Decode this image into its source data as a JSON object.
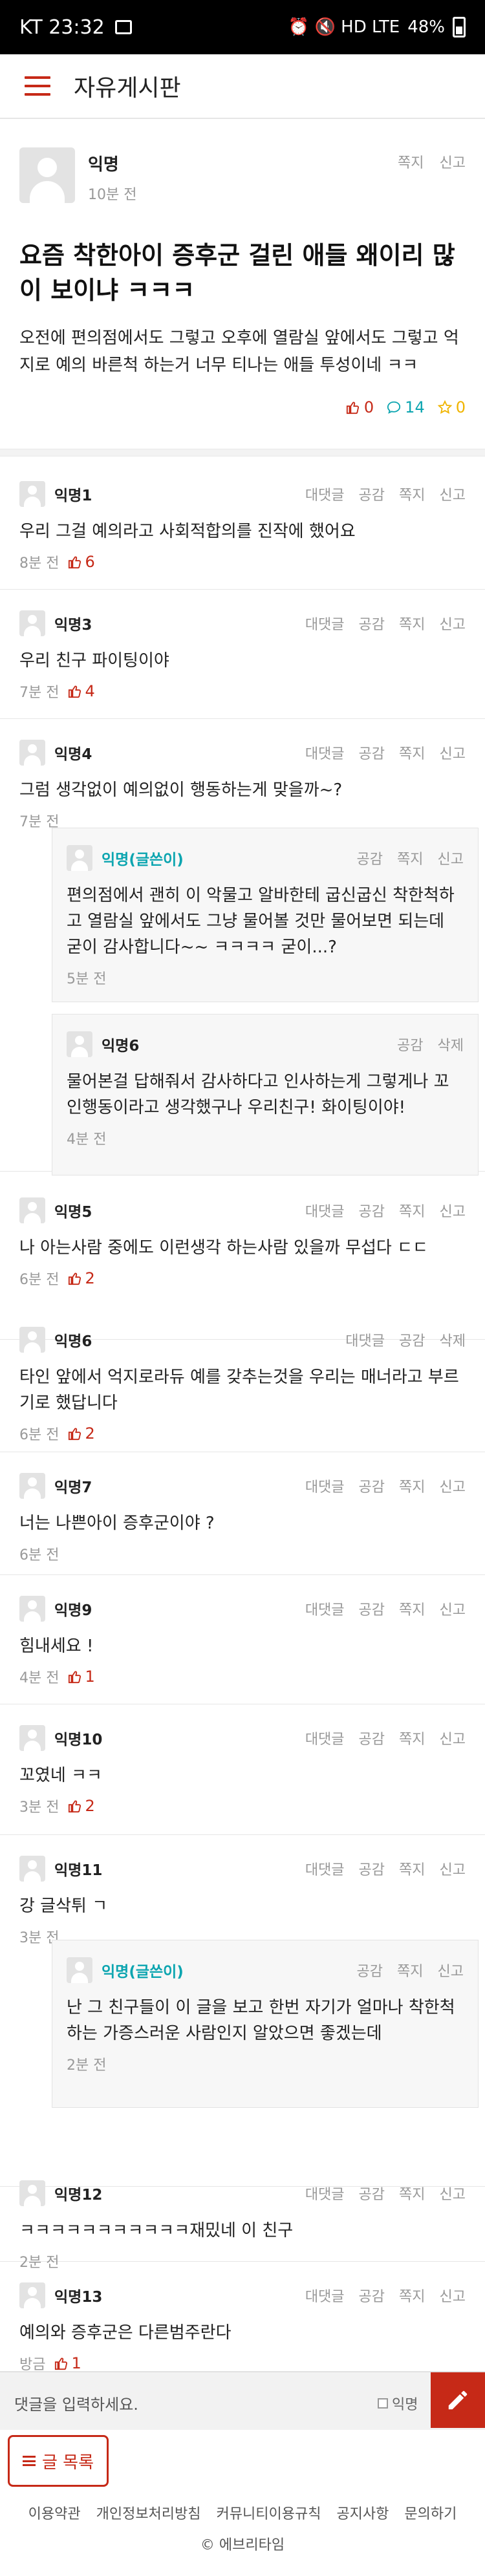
{
  "status_bar": {
    "time": "KT 23:32",
    "indicators": "⏰ 🔇 HD LTE",
    "battery": "48%"
  },
  "header": {
    "title": "자유게시판",
    "menu_icon": "hamburger-icon"
  },
  "article": {
    "author": "익명",
    "time": "10분 전",
    "actions": [
      "쪽지",
      "신고"
    ],
    "title": "요즘 착한아이 증후군 걸린 애들 왜이리 많이 보이냐 ㅋㅋㅋ",
    "body": "오전에 편의점에서도 그렇고 오후에 열람실 앞에서도 그렇고 억지로 예의 바른척 하는거 너무 티나는 애들 투성이네 ㅋㅋ",
    "likes": "0",
    "comments": "14",
    "scraps": "0"
  },
  "comments": [
    {
      "author": "익명1",
      "actions": [
        "대댓글",
        "공감",
        "쪽지",
        "신고"
      ],
      "text": "우리 그걸 예의라고 사회적합의를 진작에 했어요",
      "time": "8분 전",
      "likes": "6"
    },
    {
      "author": "익명3",
      "actions": [
        "대댓글",
        "공감",
        "쪽지",
        "신고"
      ],
      "text": "우리 친구 파이팅이야",
      "time": "7분 전",
      "likes": "4"
    },
    {
      "author": "익명4",
      "actions": [
        "대댓글",
        "공감",
        "쪽지",
        "신고"
      ],
      "text": "그럼 생각없이 예의없이 행동하는게 맞을까~?",
      "time": "7분 전",
      "likes": ""
    },
    {
      "author": "익명(글쓴이)",
      "actions": [
        "공감",
        "쪽지",
        "신고"
      ],
      "text": "편의점에서 괜히 이 악물고 알바한테 굽신굽신 착한척하고 열람실 앞에서도 그냥 물어볼 것만 물어보면 되는데 굳이 감사합니다~~ ㅋㅋㅋㅋ 굳이...?",
      "time": "5분 전",
      "likes": ""
    },
    {
      "author": "익명6",
      "actions": [
        "공감",
        "삭제"
      ],
      "text": "물어본걸 답해줘서 감사하다고 인사하는게 그렇게나 꼬인행동이라고 생각했구나 우리친구! 화이팅이야!",
      "time": "4분 전",
      "likes": ""
    },
    {
      "author": "익명5",
      "actions": [
        "대댓글",
        "공감",
        "쪽지",
        "신고"
      ],
      "text": "나 아는사람 중에도 이런생각 하는사람 있을까 무섭다 ㄷㄷ",
      "time": "6분 전",
      "likes": "2"
    },
    {
      "author": "익명6",
      "actions": [
        "대댓글",
        "공감",
        "삭제"
      ],
      "text": "타인 앞에서 억지로라듀 예를 갖추는것을 우리는 매너라고 부르기로 했답니다",
      "time": "6분 전",
      "likes": "2"
    },
    {
      "author": "익명7",
      "actions": [
        "대댓글",
        "공감",
        "쪽지",
        "신고"
      ],
      "text": "너는 나쁜아이 증후군이야 ?",
      "time": "6분 전",
      "likes": ""
    },
    {
      "author": "익명9",
      "actions": [
        "대댓글",
        "공감",
        "쪽지",
        "신고"
      ],
      "text": "힘내세요 !",
      "time": "4분 전",
      "likes": "1"
    },
    {
      "author": "익명10",
      "actions": [
        "대댓글",
        "공감",
        "쪽지",
        "신고"
      ],
      "text": "꼬였네 ㅋㅋ",
      "time": "3분 전",
      "likes": "2"
    },
    {
      "author": "익명11",
      "actions": [
        "대댓글",
        "공감",
        "쪽지",
        "신고"
      ],
      "text": "강 글삭튀 ㄱ",
      "time": "3분 전",
      "likes": ""
    },
    {
      "author": "익명(글쓴이)",
      "actions": [
        "공감",
        "쪽지",
        "신고"
      ],
      "text": "난 그 친구들이 이 글을 보고 한번 자기가 얼마나 착한척하는 가증스러운 사람인지 알았으면 좋겠는데",
      "time": "2분 전",
      "likes": ""
    },
    {
      "author": "익명12",
      "actions": [
        "대댓글",
        "공감",
        "쪽지",
        "신고"
      ],
      "text": "ㅋㅋㅋㅋㅋㅋㅋㅋㅋㅋㅋ재밌네 이 친구",
      "time": "2분 전",
      "likes": ""
    },
    {
      "author": "익명13",
      "actions": [
        "대댓글",
        "공감",
        "쪽지",
        "신고"
      ],
      "text": "예의와 증후군은 다른범주란다",
      "time": "방금",
      "likes": "1"
    }
  ],
  "comment_bar": {
    "placeholder": "댓글을 입력하세요.",
    "anon_label": "익명"
  },
  "list_button": "글 목록",
  "footer": {
    "links": [
      "이용약관",
      "개인정보처리방침",
      "커뮤니티이용규칙",
      "공지사항",
      "문의하기"
    ],
    "copyright": "© 에브리타임"
  },
  "colors": {
    "accent": "#c62917",
    "comment_teal": "#0ca5b0",
    "scrap_yellow": "#f0b400"
  }
}
